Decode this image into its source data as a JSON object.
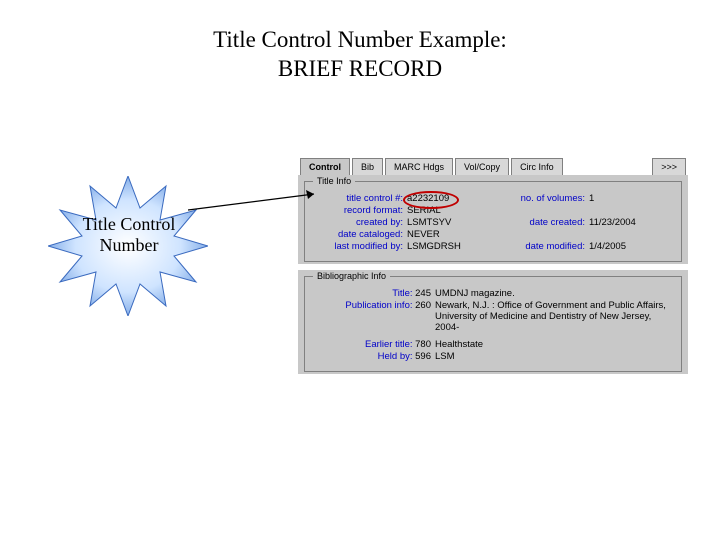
{
  "title": {
    "line1": "Title Control Number Example:",
    "line2": "BRIEF RECORD"
  },
  "callout_label": "Title Control\nNumber",
  "tabs": {
    "control": "Control",
    "bib": "Bib",
    "marc": "MARC Hdgs",
    "volcopy": "Vol/Copy",
    "circ": "Circ Info",
    "more": ">>>"
  },
  "groups": {
    "title_info_legend": "Title Info",
    "biblio_legend": "Bibliographic Info"
  },
  "title_info": {
    "rows": [
      {
        "l_lbl": "title control #:",
        "l_val": "a2232109",
        "r_lbl": "no. of volumes:",
        "r_val": "1"
      },
      {
        "l_lbl": "record format:",
        "l_val": "SERIAL",
        "r_lbl": "",
        "r_val": ""
      },
      {
        "l_lbl": "created by:",
        "l_val": "LSMTSYV",
        "r_lbl": "date created:",
        "r_val": "11/23/2004"
      },
      {
        "l_lbl": "date cataloged:",
        "l_val": "NEVER",
        "r_lbl": "",
        "r_val": ""
      },
      {
        "l_lbl": "last modified by:",
        "l_val": "LSMGDRSH",
        "r_lbl": "date modified:",
        "r_val": "1/4/2005"
      }
    ]
  },
  "biblio": {
    "rows": [
      {
        "lbl": "Title:",
        "tag": "245",
        "val": "UMDNJ magazine."
      },
      {
        "lbl": "Publication info:",
        "tag": "260",
        "val": "Newark, N.J. : Office of Government and Public Affairs, University of Medicine and Dentistry of New Jersey, 2004-"
      },
      {
        "lbl": "Earlier title:",
        "tag": "780",
        "val": "Healthstate"
      },
      {
        "lbl": "Held by:",
        "tag": "596",
        "val": "LSM"
      }
    ]
  },
  "colors": {
    "label_blue": "#0000c8",
    "oval_red": "#c00000",
    "panel_gray": "#c8c8c8"
  }
}
